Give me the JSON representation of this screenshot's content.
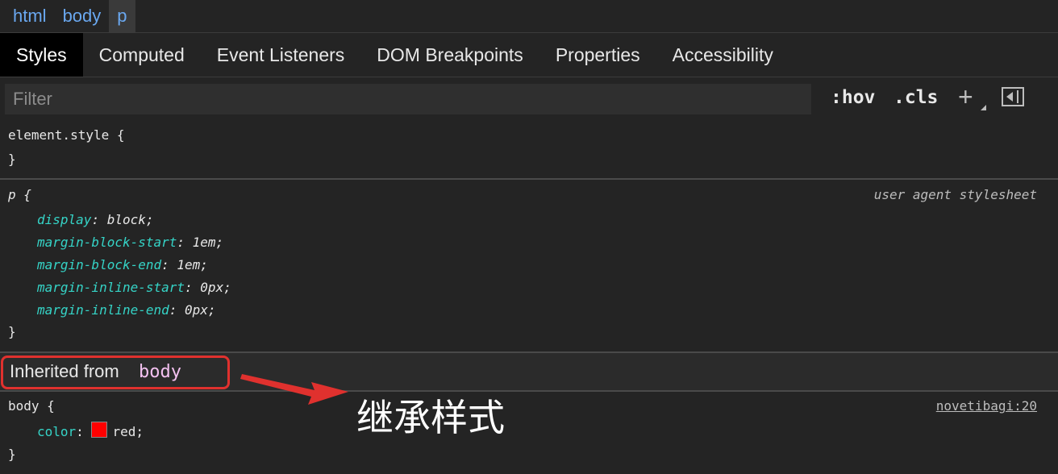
{
  "breadcrumb": [
    "html",
    "body",
    "p"
  ],
  "tabs": [
    "Styles",
    "Computed",
    "Event Listeners",
    "DOM Breakpoints",
    "Properties",
    "Accessibility"
  ],
  "filter": {
    "placeholder": "Filter"
  },
  "toolbar": {
    "hov": ":hov",
    "cls": ".cls",
    "plus": "+"
  },
  "element_style": {
    "open": "element.style {",
    "close": "}"
  },
  "p_rule": {
    "selector": "p {",
    "source": "user agent stylesheet",
    "declarations": [
      {
        "prop": "display",
        "value": "block;"
      },
      {
        "prop": "margin-block-start",
        "value": "1em;"
      },
      {
        "prop": "margin-block-end",
        "value": "1em;"
      },
      {
        "prop": "margin-inline-start",
        "value": "0px;"
      },
      {
        "prop": "margin-inline-end",
        "value": "0px;"
      }
    ],
    "close": "}"
  },
  "inherited": {
    "label": "Inherited from",
    "selector": "body"
  },
  "body_rule": {
    "selector": "body {",
    "source": "novetibagi:20",
    "prop": "color",
    "value": "red;",
    "swatch_color": "#ff0000",
    "close": "}"
  },
  "annotation": {
    "text": "继承样式",
    "color": "#e0312e"
  }
}
